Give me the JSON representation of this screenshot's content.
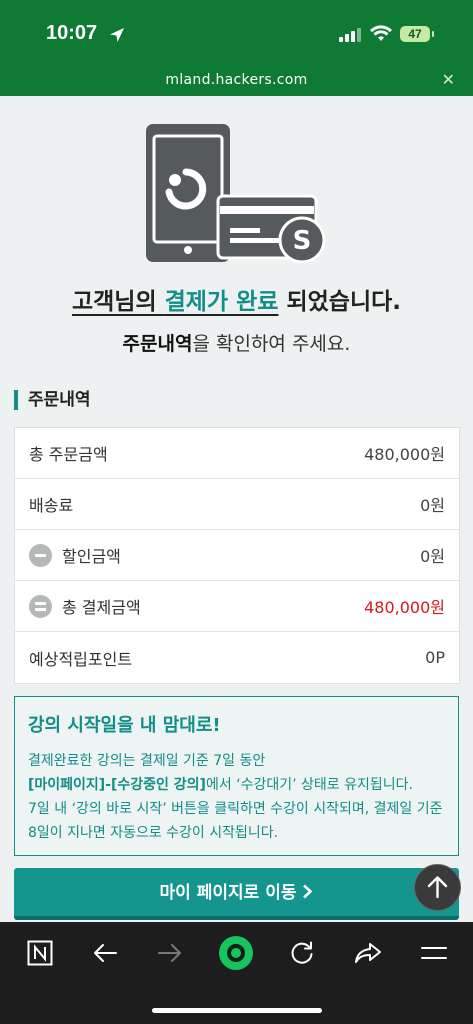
{
  "status_bar": {
    "time": "10:07",
    "battery": "47"
  },
  "browser": {
    "url": "mland.hackers.com",
    "close_icon": "close-icon"
  },
  "hero": {
    "line1_a": "고객님의 ",
    "line1_highlight": "결제가 완료",
    "line1_b": " 되었습니다.",
    "line2_bold": "주문내역",
    "line2_rest": "을 확인하여 주세요."
  },
  "order": {
    "section_title": "주문내역",
    "rows": [
      {
        "label": "총 주문금액",
        "value": "480,000원"
      },
      {
        "label": "배송료",
        "value": "0원"
      },
      {
        "label": "할인금액",
        "value": "0원"
      },
      {
        "label": "총 결제금액",
        "value": "480,000원"
      },
      {
        "label": "예상적립포인트",
        "value": "0P"
      }
    ],
    "accent_red": "#d41a1a"
  },
  "notice": {
    "title": "강의 시작일을 내 맘대로!",
    "line1": "결제완료한 강의는 결제일 기준 7일 동안",
    "line2_bold": "[마이페이지]-[수강중인 강의]",
    "line2_rest": "에서 ‘수강대기’ 상태로 유지됩니다.",
    "line3": "7일 내 ‘강의 바로 시작’ 버튼을 클릭하면 수강이 시작되며, 결제일 기준",
    "line4": "8일이 지나면 자동으로 수강이 시작됩니다."
  },
  "cta": {
    "label": "마이 페이지로 이동",
    "color": "#14958d"
  },
  "colors": {
    "header_green": "#0e7a34",
    "teal": "#118e87"
  }
}
